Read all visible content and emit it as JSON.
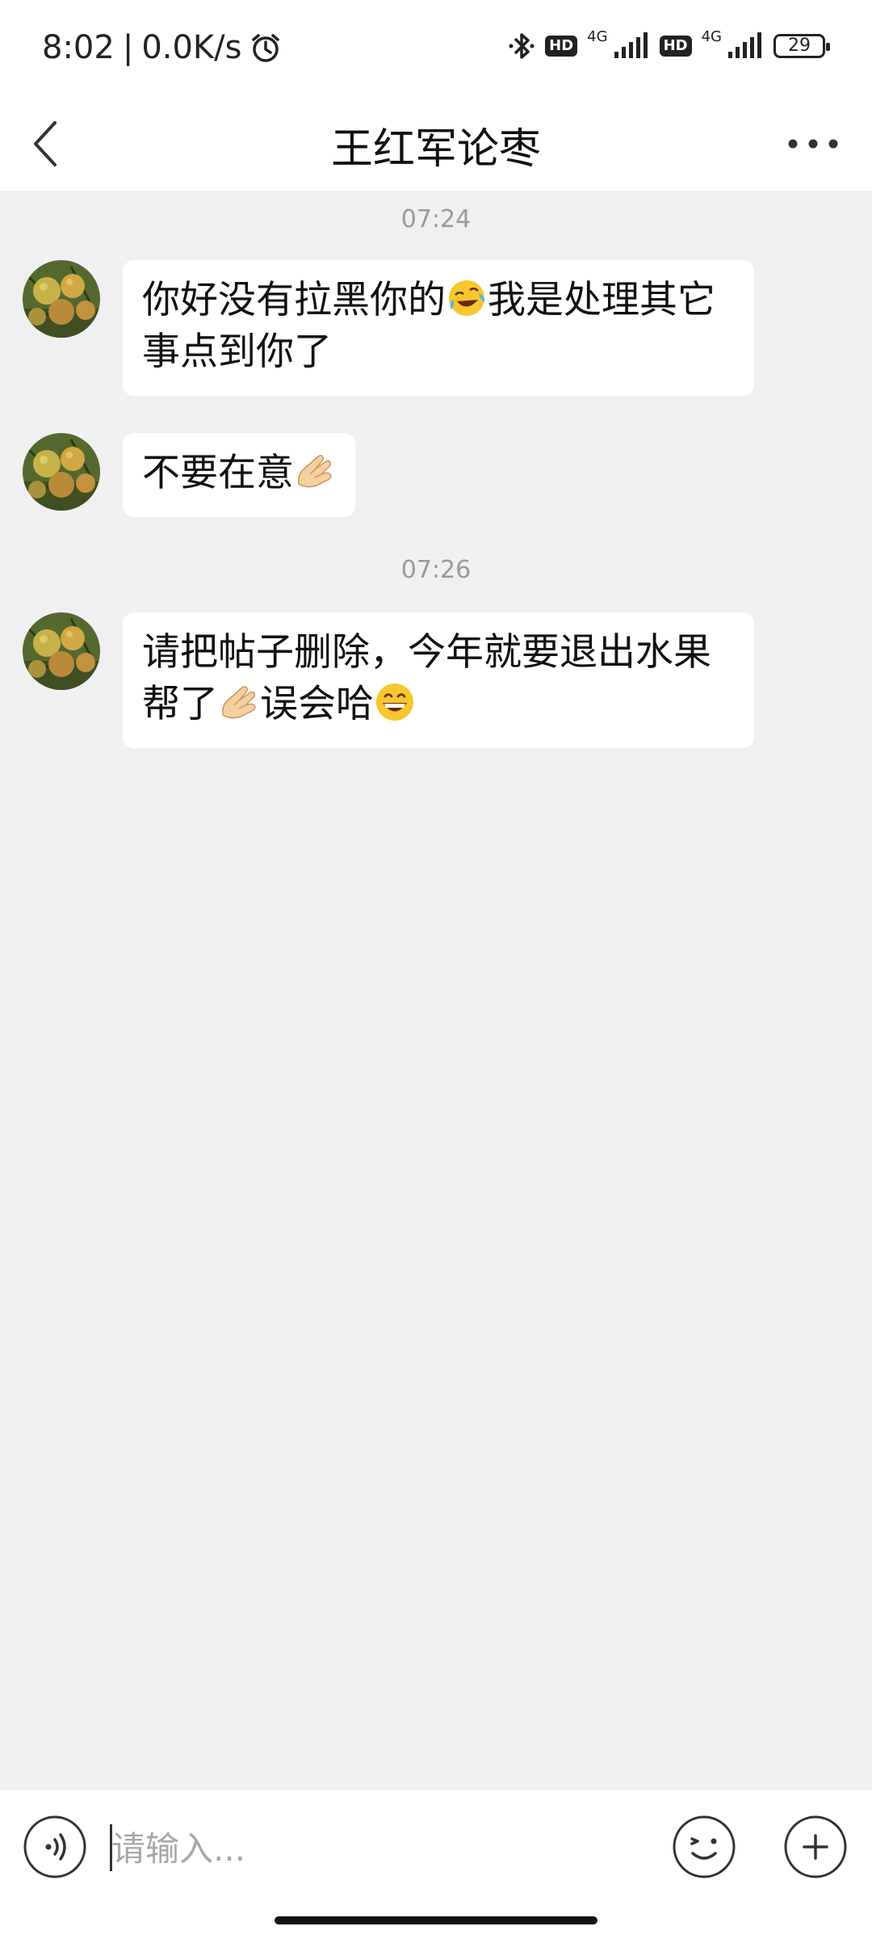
{
  "status_bar": {
    "time": "8:02",
    "speed": "0.0K/s",
    "hd_label": "HD",
    "network": "4G",
    "battery": "29"
  },
  "header": {
    "title": "王红军论枣"
  },
  "messages": [
    {
      "timestamp": "07:24"
    },
    {
      "text_before": "你好没有拉黑你的",
      "emoji": "laughing-crying-emoji",
      "text_after": "我是处理其它事点到你了"
    },
    {
      "text_before": "不要在意",
      "emoji": "pinching-hand-emoji"
    },
    {
      "timestamp": "07:26"
    },
    {
      "text_before": "请把帖子删除，今年就要退出水果帮了",
      "emoji": "pinching-hand-emoji",
      "text_middle": "误会哈",
      "emoji2": "grinning-emoji"
    }
  ],
  "input_bar": {
    "placeholder": "请输入..."
  },
  "colors": {
    "background": "#f0f0f0",
    "bubble": "#ffffff",
    "timestamp": "#9a9a9a"
  }
}
